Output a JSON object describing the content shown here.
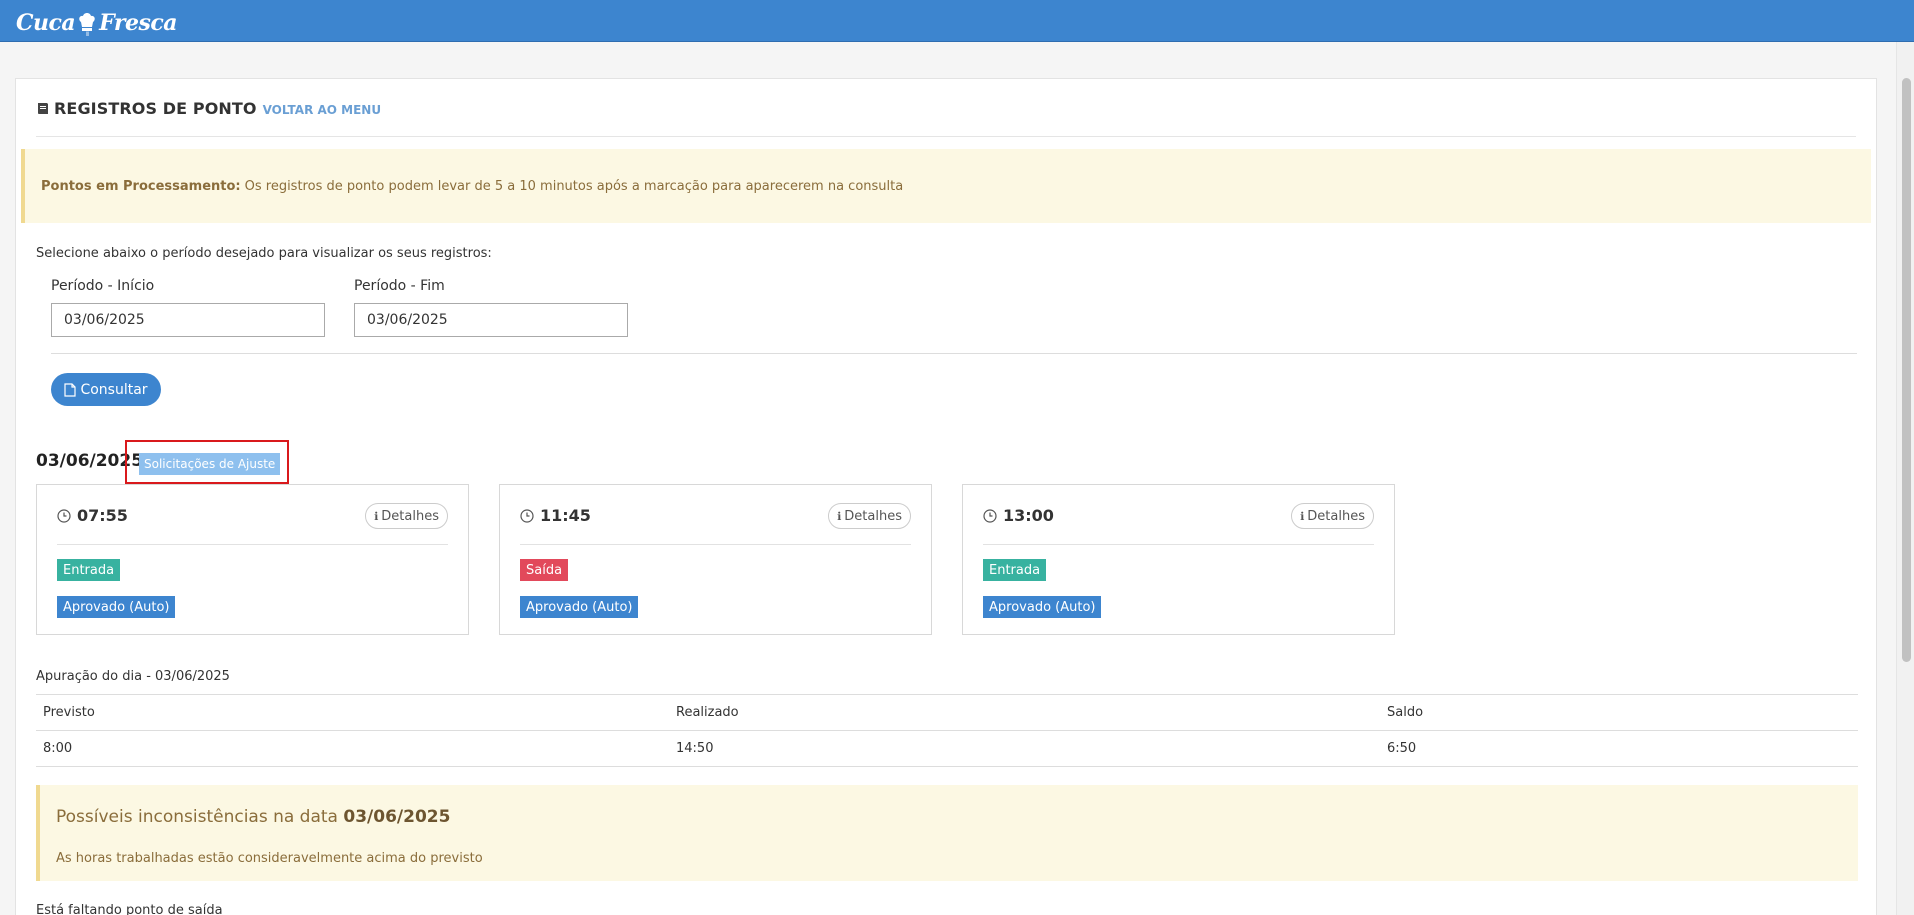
{
  "app": {
    "logo_word1": "Cuca",
    "logo_word2": "Fresca",
    "brand_color": "#3d85cf"
  },
  "header": {
    "title": "REGISTROS DE PONTO",
    "back_link": "VOLTAR AO MENU"
  },
  "processing_alert": {
    "bold": "Pontos em Processamento:",
    "text": "Os registros de ponto podem levar de 5 a 10 minutos após a marcação para aparecerem na consulta"
  },
  "period": {
    "instruction": "Selecione abaixo o período desejado para visualizar os seus registros:",
    "start_label": "Período - Início",
    "start_value": "03/06/2025",
    "end_label": "Período - Fim",
    "end_value": "03/06/2025",
    "submit_label": "Consultar"
  },
  "day": {
    "date": "03/06/2025",
    "adjust_badge": "Solicitações de Ajuste",
    "punches": [
      {
        "time": "07:55",
        "details_label": "Detalhes",
        "type": "Entrada",
        "status": "Aprovado (Auto)",
        "type_color": "green"
      },
      {
        "time": "11:45",
        "details_label": "Detalhes",
        "type": "Saída",
        "status": "Aprovado (Auto)",
        "type_color": "red"
      },
      {
        "time": "13:00",
        "details_label": "Detalhes",
        "type": "Entrada",
        "status": "Aprovado (Auto)",
        "type_color": "green"
      }
    ]
  },
  "summary": {
    "title": "Apuração do dia - 03/06/2025",
    "headers": [
      "Previsto",
      "Realizado",
      "Saldo"
    ],
    "values": [
      "8:00",
      "14:50",
      "6:50"
    ]
  },
  "inconsistency": {
    "heading_prefix": "Possíveis inconsistências na data",
    "heading_date": "03/06/2025",
    "message": "As horas trabalhadas estão consideravelmente acima do previsto"
  },
  "missing_note": "Está faltando ponto de saída"
}
